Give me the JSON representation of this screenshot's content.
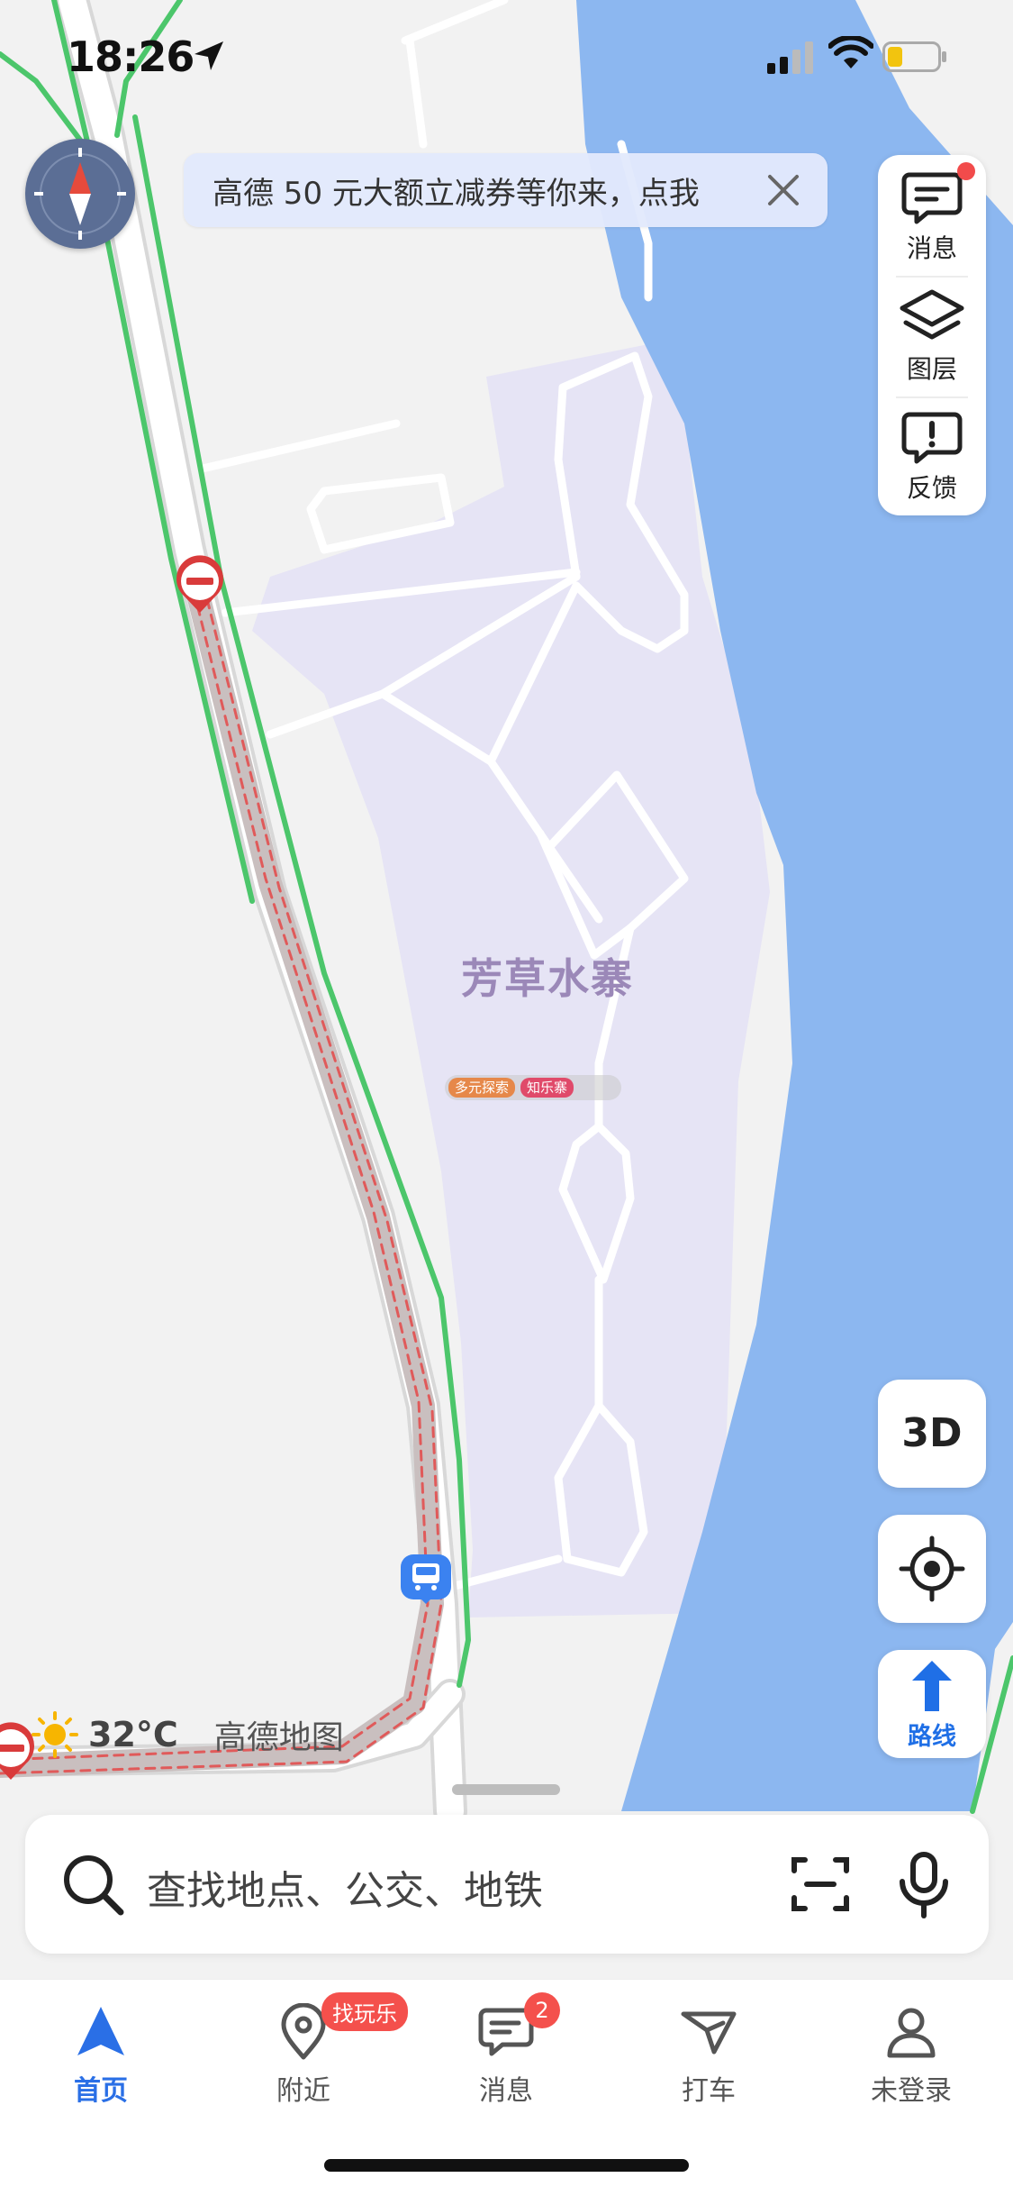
{
  "status_bar": {
    "time": "18:26",
    "signal_icon": "cellular-signal-icon",
    "wifi_icon": "wifi-icon",
    "battery_icon": "battery-low-icon",
    "location_icon": "location-arrow-icon"
  },
  "promo_banner": {
    "text": "高德 50 元大额立减券等你来，点我",
    "close_icon": "close-icon"
  },
  "right_toolbar": {
    "items": [
      {
        "label": "消息",
        "icon": "message-icon",
        "has_dot": true
      },
      {
        "label": "图层",
        "icon": "layers-icon"
      },
      {
        "label": "反馈",
        "icon": "feedback-icon"
      }
    ]
  },
  "map": {
    "poi_name": "芳草水寨",
    "poi_tags": [
      "多元探索",
      "知乐寨"
    ],
    "weather_icon": "sun-icon",
    "temperature": "32°C",
    "brand": "高德地图",
    "colors": {
      "land": "#f2f2f2",
      "park": "#e8e6f6",
      "water": "#8cb7f0",
      "road": "#ffffff",
      "green_route": "#4cc66b"
    }
  },
  "controls": {
    "btn_3d": "3D",
    "locate_icon": "crosshair-icon",
    "route_icon": "route-arrow-icon",
    "route_label": "路线"
  },
  "search": {
    "placeholder": "查找地点、公交、地铁",
    "search_icon": "search-icon",
    "scan_icon": "scan-icon",
    "mic_icon": "microphone-icon"
  },
  "tabbar": {
    "tabs": [
      {
        "label": "首页",
        "icon": "navigation-arrow-icon",
        "active": true
      },
      {
        "label": "附近",
        "icon": "location-pin-icon",
        "badge": "找玩乐"
      },
      {
        "label": "消息",
        "icon": "chat-icon",
        "badge": "2"
      },
      {
        "label": "打车",
        "icon": "taxi-icon"
      },
      {
        "label": "未登录",
        "icon": "user-icon"
      }
    ]
  }
}
